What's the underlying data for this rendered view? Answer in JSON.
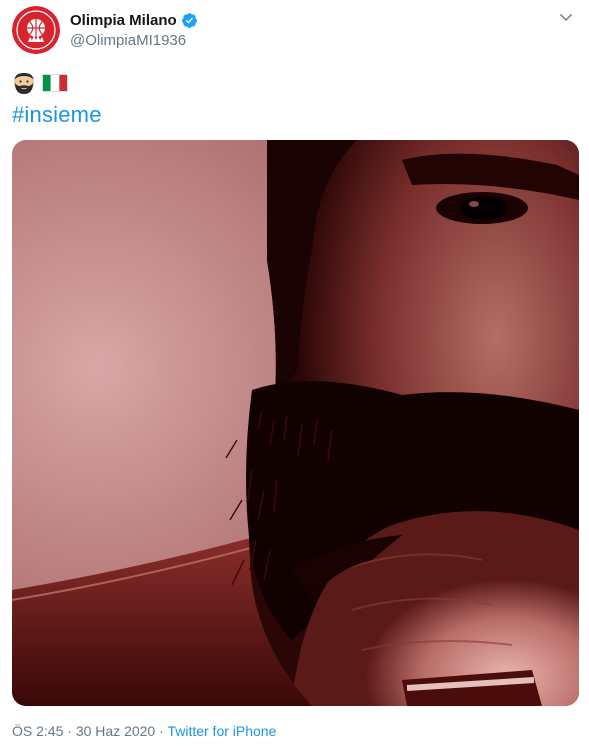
{
  "account": {
    "display_name": "Olimpia Milano",
    "handle": "@OlimpiaMI1936",
    "verified": true,
    "avatar_icon": "olimpia-milano-logo",
    "avatar_logo_text": "OLIMPIA",
    "avatar_logo_subtext": "MILANO",
    "brand_color": "#d9232e"
  },
  "tweet": {
    "emojis": [
      "bearded-man-emoji",
      "italy-flag-emoji"
    ],
    "hashtag": "#insieme",
    "media": {
      "type": "photo",
      "description_icon": "bearded-player-photo"
    }
  },
  "meta": {
    "time": "ÖS 2:45",
    "separator": "·",
    "date": "30 Haz 2020",
    "source": "Twitter for iPhone"
  },
  "colors": {
    "link": "#1b95e0",
    "secondary_text": "#657786",
    "verified_badge": "#1da1f2"
  }
}
